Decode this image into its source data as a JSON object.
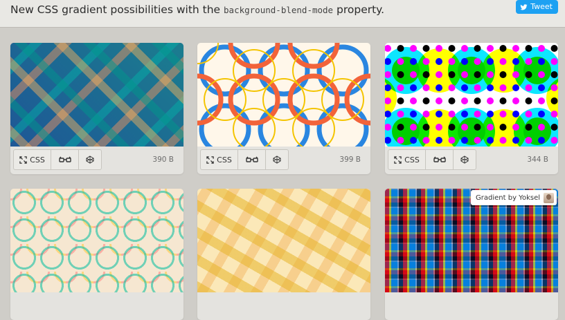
{
  "header": {
    "text_before": "New CSS gradient possibilities with the ",
    "code": "background-blend-mode",
    "text_after": " property.",
    "tweet_label": "Tweet"
  },
  "cards": [
    {
      "css_label": "CSS",
      "size": "390 B"
    },
    {
      "css_label": "CSS",
      "size": "399 B"
    },
    {
      "css_label": "CSS",
      "size": "344 B"
    },
    {},
    {},
    {
      "author": "Gradient by Yoksel"
    }
  ],
  "colors": {
    "page_bg": "#cfcdc8",
    "header_bg": "#e9e8e4",
    "tweet_blue": "#1da1f2"
  },
  "icons": [
    "twitter-bird-icon",
    "expand-arrows-icon",
    "3d-glasses-icon",
    "codepen-icon"
  ]
}
